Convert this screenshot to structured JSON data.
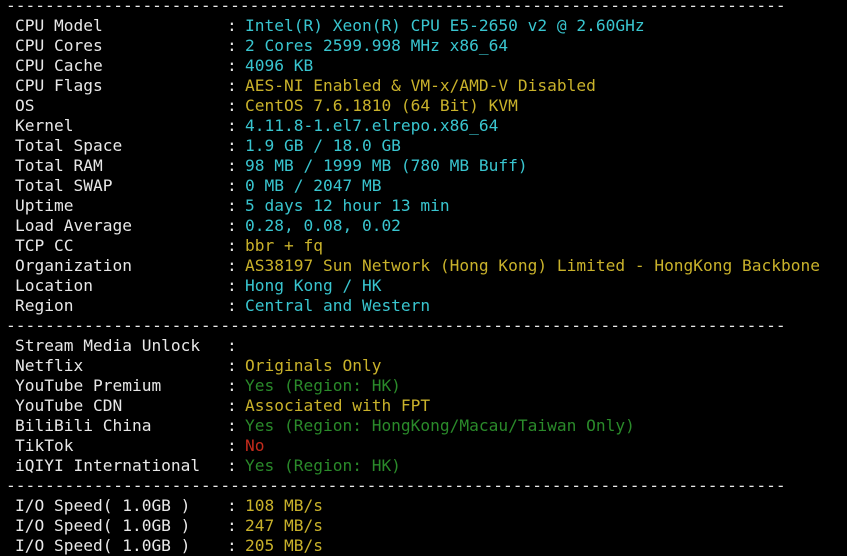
{
  "colors": {
    "background": "#000000",
    "label": "#e8e8e8",
    "cyan": "#39c5cf",
    "yellow": "#c9b22b",
    "green": "#2a8a2a",
    "red": "#c42b1c"
  },
  "separator": "--------------------------------------------------------------------------------",
  "system_info": [
    {
      "label": "CPU Model",
      "value": "Intel(R) Xeon(R) CPU E5-2650 v2 @ 2.60GHz",
      "color": "cyan"
    },
    {
      "label": "CPU Cores",
      "value": "2 Cores 2599.998 MHz x86_64",
      "color": "cyan"
    },
    {
      "label": "CPU Cache",
      "value": "4096 KB",
      "color": "cyan"
    },
    {
      "label": "CPU Flags",
      "value": "AES-NI Enabled & VM-x/AMD-V Disabled",
      "color": "yellow"
    },
    {
      "label": "OS",
      "value": "CentOS 7.6.1810 (64 Bit) KVM",
      "color": "yellow"
    },
    {
      "label": "Kernel",
      "value": "4.11.8-1.el7.elrepo.x86_64",
      "color": "cyan"
    },
    {
      "label": "Total Space",
      "value": "1.9 GB / 18.0 GB",
      "color": "cyan"
    },
    {
      "label": "Total RAM",
      "value": "98 MB / 1999 MB (780 MB Buff)",
      "color": "cyan"
    },
    {
      "label": "Total SWAP",
      "value": "0 MB / 2047 MB",
      "color": "cyan"
    },
    {
      "label": "Uptime",
      "value": "5 days 12 hour 13 min",
      "color": "cyan"
    },
    {
      "label": "Load Average",
      "value": "0.28, 0.08, 0.02",
      "color": "cyan"
    },
    {
      "label": "TCP CC",
      "value": "bbr + fq",
      "color": "yellow"
    },
    {
      "label": "Organization",
      "value": "AS38197 Sun Network (Hong Kong) Limited - HongKong Backbone",
      "color": "yellow"
    },
    {
      "label": "Location",
      "value": "Hong Kong / HK",
      "color": "cyan"
    },
    {
      "label": "Region",
      "value": "Central and Western",
      "color": "cyan"
    }
  ],
  "stream_info": [
    {
      "label": "Stream Media Unlock",
      "value": "",
      "color": "cyan"
    },
    {
      "label": "Netflix",
      "value": "Originals Only",
      "color": "yellow"
    },
    {
      "label": "YouTube Premium",
      "value": "Yes (Region: HK)",
      "color": "green"
    },
    {
      "label": "YouTube CDN",
      "value": "Associated with FPT",
      "color": "yellow"
    },
    {
      "label": "BiliBili China",
      "value": "Yes (Region: HongKong/Macau/Taiwan Only)",
      "color": "green"
    },
    {
      "label": "TikTok",
      "value": "No",
      "color": "red"
    },
    {
      "label": "iQIYI International",
      "value": "Yes (Region: HK)",
      "color": "green"
    }
  ],
  "io_info": [
    {
      "label": "I/O Speed( 1.0GB )",
      "value": "108 MB/s",
      "color": "yellow"
    },
    {
      "label": "I/O Speed( 1.0GB )",
      "value": "247 MB/s",
      "color": "yellow"
    },
    {
      "label": "I/O Speed( 1.0GB )",
      "value": "205 MB/s",
      "color": "yellow"
    }
  ]
}
